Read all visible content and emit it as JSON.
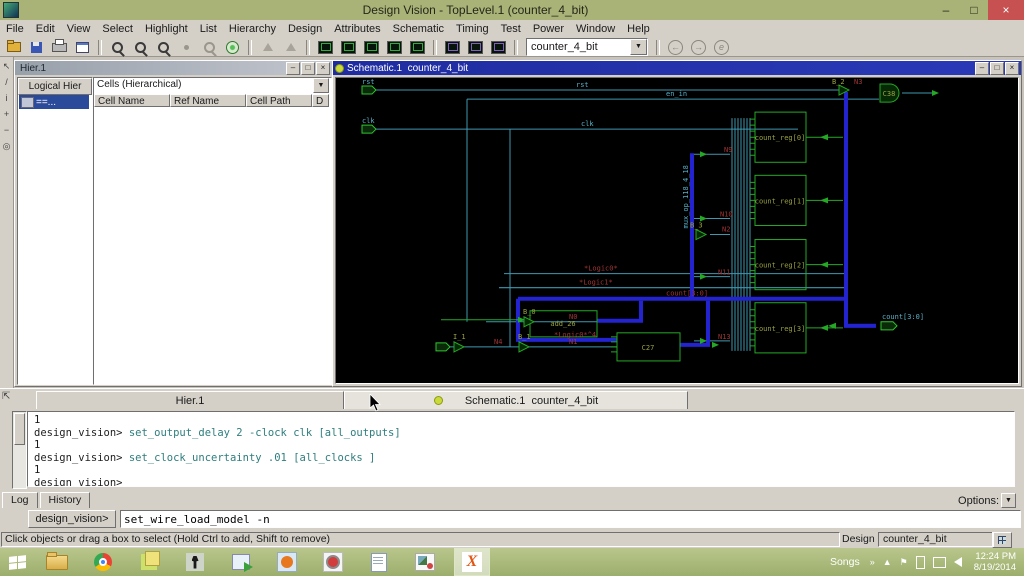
{
  "window": {
    "title": "Design Vision - TopLevel.1 (counter_4_bit)"
  },
  "menu": {
    "items": [
      "File",
      "Edit",
      "View",
      "Select",
      "Highlight",
      "List",
      "Hierarchy",
      "Design",
      "Attributes",
      "Schematic",
      "Timing",
      "Test",
      "Power",
      "Window",
      "Help"
    ]
  },
  "toolbar": {
    "design_select": "counter_4_bit"
  },
  "hier": {
    "title": "Hier.1",
    "pane_header": "Logical Hier",
    "tree_item": "==...",
    "cells_dropdown": "Cells (Hierarchical)",
    "columns": [
      "Cell Name",
      "Ref Name",
      "Cell Path",
      "D"
    ]
  },
  "schematic": {
    "title": "Schematic.1  counter_4_bit",
    "port_rst": "rst",
    "port_clk": "clk",
    "port_count": "count[3:0]",
    "wire_rst": "rst",
    "wire_clk": "clk",
    "wire_en": "en_in",
    "reg0": "count_reg[0]",
    "reg1": "count_reg[1]",
    "reg2": "count_reg[2]",
    "reg3": "count_reg[3]",
    "add": "add_26",
    "c27": "C27",
    "c38": "C38",
    "g_i1": "I_1",
    "g_b0": "B_0",
    "g_b1": "B_1",
    "g_b2": "B_2",
    "g_b3": "B_3",
    "n0": "N0",
    "n1": "N1",
    "n2": "N2",
    "n3": "N3",
    "n4": "N4",
    "n9": "N9",
    "n10": "N10",
    "n11": "N11",
    "n13": "N13",
    "logic0": "*Logic0*",
    "logic1": "*Logic1*",
    "logic0_4": "*Logic0*^4",
    "bus_count": "count[3:0]",
    "mux_label": "mux_op_118_4_18"
  },
  "tabs": {
    "hier": "Hier.1",
    "schematic": "Schematic.1  counter_4_bit"
  },
  "console": {
    "l0": "1",
    "p1": "design_vision>",
    "c1": "set_output_delay 2 -clock clk [all_outputs]",
    "l2": "1",
    "p3": "design_vision>",
    "c3": "set_clock_uncertainty .01 [all_clocks ]",
    "l4": "1",
    "p5": "design_vision>"
  },
  "logtabs": {
    "log": "Log",
    "history": "History",
    "options": "Options:"
  },
  "command": {
    "prompt": "design_vision>",
    "value": "set_wire_load_model -n"
  },
  "statusbar": {
    "message": "Click objects or drag a box to select (Hold Ctrl to add, Shift to remove)",
    "design_label": "Design",
    "design_value": "counter_4_bit"
  },
  "taskbar": {
    "tray_label": "Songs",
    "chevron": "»",
    "time": "12:24 PM",
    "date": "8/19/2014"
  },
  "icons": {
    "minimize": "–",
    "maximize": "□",
    "close": "×",
    "dropdown": "▼",
    "tray_arrow": "▲",
    "flag": "⚑",
    "back": "←",
    "forward": "→",
    "redo": "e",
    "cursor_tool": "↖",
    "wire_tool": "/",
    "info_tool": "i",
    "zoom_in_tool": "+",
    "zoom_out_tool": "−",
    "pan_tool": "◎",
    "corner_widget": "⇱"
  },
  "colors": {
    "title_olive": "#a9b377",
    "active_title_blue": "#2432ac",
    "wire_cyan": "#3f98b0",
    "bus_blue": "#2323cf",
    "component_green": "#25a825",
    "net_red": "#a03535",
    "label_olive": "#9aa23f"
  }
}
